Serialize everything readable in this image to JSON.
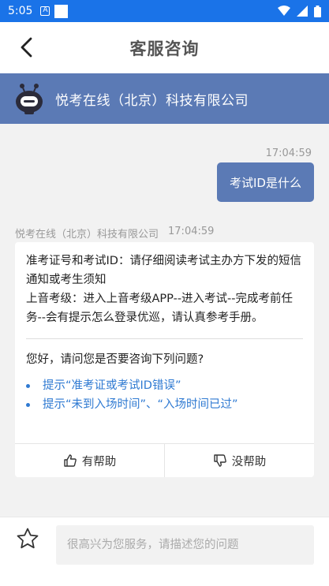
{
  "status_bar": {
    "time": "5:05",
    "icon_label": "A"
  },
  "header": {
    "title": "客服咨询"
  },
  "company": {
    "name": "悦考在线（北京）科技有限公司"
  },
  "chat": {
    "user_message": {
      "timestamp": "17:04:59",
      "text": "考试ID是什么"
    },
    "bot_message": {
      "sender": "悦考在线（北京）科技有限公司",
      "timestamp": "17:04:59",
      "answer_line1": "准考证号和考试ID：请仔细阅读考试主办方下发的短信通知或考生须知",
      "answer_line2": "上音考级：进入上音考级APP--进入考试--完成考前任务--会有提示怎么登录优巡，请认真参考手册。",
      "question": "您好，请问您是否要咨询下列问题?",
      "suggestions": [
        "提示“准考证或考试ID错误”",
        "提示“未到入场时间”、“入场时间已过”"
      ],
      "helpful_label": "有帮助",
      "unhelpful_label": "没帮助"
    }
  },
  "input": {
    "placeholder": "很高兴为您服务，请描述您的问题"
  },
  "colors": {
    "status_bar": "#1a73e8",
    "accent": "#5b7ab5",
    "link": "#2f7ad2"
  }
}
